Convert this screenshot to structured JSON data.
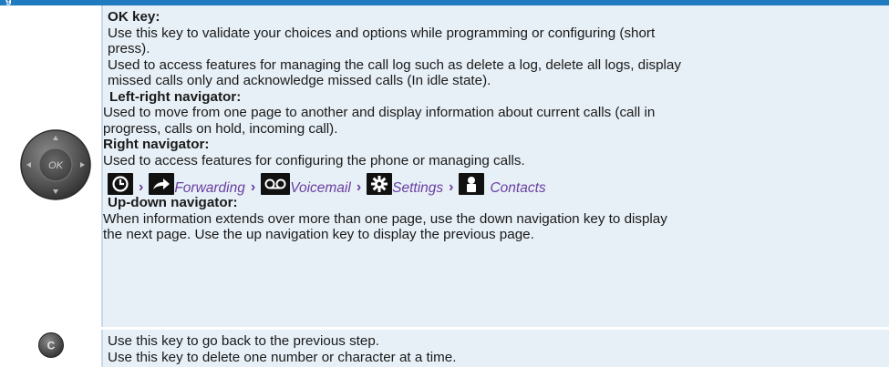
{
  "header": {
    "partial_title": "g"
  },
  "row1": {
    "ok_key_title": "OK key:",
    "ok_key_lines": [
      "Use this key to validate your choices and options while programming or configuring (short",
      "press).",
      "Used to access features for managing the call log such as delete a log, delete all logs, display",
      "missed calls only and acknowledge missed calls (In idle state)."
    ],
    "left_right_title": "Left-right navigator:",
    "left_right_lines": [
      "Used to move from one page to another and display information about current calls (call in",
      "progress, calls on hold, incoming call)."
    ],
    "right_title": "Right navigator:",
    "right_lines": [
      "Used to access features for configuring the phone or managing calls."
    ],
    "nav_items": {
      "forwarding": "Forwarding",
      "voicemail": "Voicemail",
      "settings": "Settings",
      "contacts": "Contacts"
    },
    "up_down_title": "Up-down navigator:",
    "up_down_lines": [
      "When information extends over more than one page, use the down navigation key to display",
      "the next page. Use the up navigation key to display the previous page."
    ],
    "ok_button_label": "OK"
  },
  "row2": {
    "c_button_label": "C",
    "lines": [
      "Use this key to go back to the previous step.",
      "Use this key to delete one number or character at a time."
    ]
  },
  "colors": {
    "header_blue": "#1f7ac0",
    "row_bg": "#e7f0f7",
    "link_purple": "#6a3ea1"
  }
}
